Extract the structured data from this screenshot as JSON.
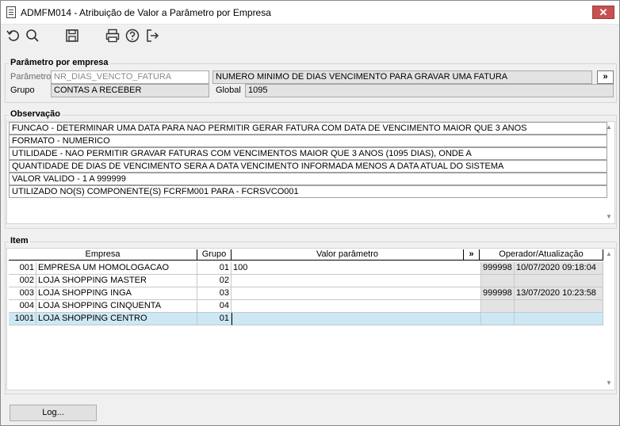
{
  "window": {
    "title": "ADMFM014 - Atribuição de Valor a Parâmetro por Empresa",
    "close_label": "✕"
  },
  "toolbar": {
    "icons": [
      "refresh-icon",
      "search-icon",
      "save-icon",
      "print-icon",
      "help-icon",
      "exit-icon"
    ]
  },
  "parametro_group": {
    "legend": "Parâmetro por empresa",
    "parametro_label": "Parâmetro",
    "parametro_value": "NR_DIAS_VENCTO_FATURA",
    "descricao_value": "NUMERO MINIMO DE DIAS VENCIMENTO PARA GRAVAR UMA FATURA",
    "expand_label": "»",
    "grupo_label": "Grupo",
    "grupo_value": "CONTAS A RECEBER",
    "global_label": "Global",
    "global_value": "1095"
  },
  "observacao": {
    "legend": "Observação",
    "lines": [
      "FUNCAO - DETERMINAR UMA DATA PARA NAO PERMITIR GERAR FATURA COM DATA DE VENCIMENTO MAIOR QUE 3 ANOS",
      "FORMATO - NUMERICO",
      "UTILIDADE - NAO PERMITIR GRAVAR FATURAS COM VENCIMENTOS MAIOR QUE 3 ANOS (1095 DIAS), ONDE A",
      "QUANTIDADE DE DIAS DE VENCIMENTO SERA A DATA VENCIMENTO INFORMADA MENOS A DATA ATUAL DO SISTEMA",
      "VALOR VALIDO - 1 A 999999",
      "UTILIZADO NO(S) COMPONENTE(S) FCRFM001  PARA - FCRSVCO001"
    ]
  },
  "item": {
    "legend": "Item",
    "columns": {
      "empresa": "Empresa",
      "grupo": "Grupo",
      "valor": "Valor parâmetro",
      "expand": "»",
      "operador": "Operador/Atualização"
    },
    "rows": [
      {
        "code": "001",
        "empresa": "EMPRESA UM  HOMOLOGACAO",
        "grupo": "01",
        "valor": "100",
        "operador": "999998",
        "data": "10/07/2020 09:18:04"
      },
      {
        "code": "002",
        "empresa": "LOJA SHOPPING MASTER",
        "grupo": "02",
        "valor": "",
        "operador": "",
        "data": ""
      },
      {
        "code": "003",
        "empresa": "LOJA SHOPPING INGA",
        "grupo": "03",
        "valor": "",
        "operador": "999998",
        "data": "13/07/2020 10:23:58"
      },
      {
        "code": "004",
        "empresa": "LOJA SHOPPING CINQUENTA",
        "grupo": "04",
        "valor": "",
        "operador": "",
        "data": ""
      },
      {
        "code": "1001",
        "empresa": "LOJA SHOPPING  CENTRO",
        "grupo": "01",
        "valor": "",
        "operador": "",
        "data": ""
      }
    ]
  },
  "footer": {
    "log_label": "Log..."
  }
}
